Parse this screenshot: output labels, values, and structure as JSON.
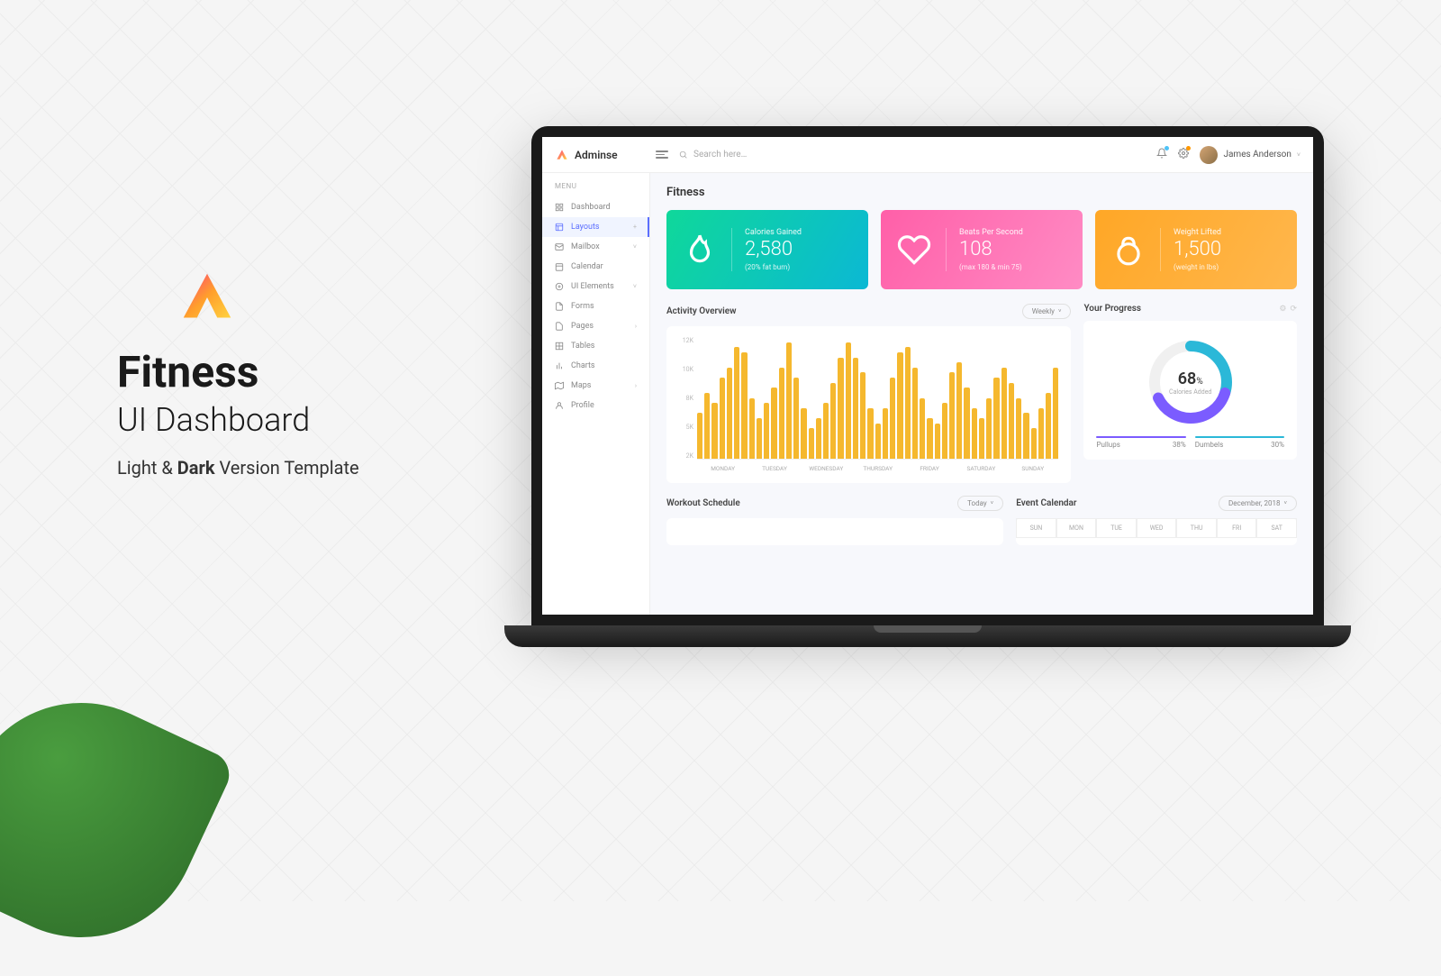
{
  "promo": {
    "title": "Fitness",
    "subtitle": "UI Dashboard",
    "tagline_pre": "Light & ",
    "tagline_bold": "Dark",
    "tagline_post": " Version Template"
  },
  "brand": "Adminse",
  "search": {
    "placeholder": "Search here…"
  },
  "user": {
    "name": "James Anderson"
  },
  "sidebar": {
    "label": "MENU",
    "items": [
      {
        "label": "Dashboard",
        "icon": "grid",
        "expand": false
      },
      {
        "label": "Layouts",
        "icon": "layout",
        "active": true,
        "expand": true,
        "caret": "+"
      },
      {
        "label": "Mailbox",
        "icon": "mail",
        "expand": true,
        "caret": "˅"
      },
      {
        "label": "Calendar",
        "icon": "calendar",
        "expand": false
      },
      {
        "label": "UI Elements",
        "icon": "ui",
        "expand": true,
        "caret": "˅"
      },
      {
        "label": "Forms",
        "icon": "form",
        "expand": false
      },
      {
        "label": "Pages",
        "icon": "pages",
        "expand": true,
        "caret": "›"
      },
      {
        "label": "Tables",
        "icon": "table",
        "expand": false
      },
      {
        "label": "Charts",
        "icon": "chart",
        "expand": false
      },
      {
        "label": "Maps",
        "icon": "map",
        "expand": true,
        "caret": "›"
      },
      {
        "label": "Profile",
        "icon": "profile",
        "expand": false
      }
    ]
  },
  "page": {
    "title": "Fitness"
  },
  "stat_cards": [
    {
      "label": "Calories Gained",
      "value": "2,580",
      "sub": "(20% fat burn)",
      "icon": "flame"
    },
    {
      "label": "Beats Per Second",
      "value": "108",
      "sub": "(max 180 & min 75)",
      "icon": "heart"
    },
    {
      "label": "Weight Lifted",
      "value": "1,500",
      "sub": "(weight in lbs)",
      "icon": "kettlebell"
    }
  ],
  "activity": {
    "title": "Activity Overview",
    "range": "Weekly"
  },
  "progress": {
    "title": "Your Progress",
    "percent": "68",
    "percent_sign": "%",
    "label": "Calories Added",
    "legend": [
      {
        "name": "Pullups",
        "value": "38%",
        "color": "#7b5cff"
      },
      {
        "name": "Dumbels",
        "value": "30%",
        "color": "#2bb8d8"
      }
    ]
  },
  "workout": {
    "title": "Workout Schedule",
    "range": "Today"
  },
  "calendar": {
    "title": "Event Calendar",
    "range": "December, 2018",
    "days": [
      "SUN",
      "MON",
      "TUE",
      "WED",
      "THU",
      "FRI",
      "SAT"
    ]
  },
  "chart_data": {
    "type": "bar",
    "title": "Activity Overview",
    "ylabel": "",
    "ylim": [
      0,
      12
    ],
    "y_ticks": [
      "12K",
      "10K",
      "8K",
      "5K",
      "2K"
    ],
    "categories": [
      "MONDAY",
      "TUESDAY",
      "WEDNESDAY",
      "THURSDAY",
      "FRIDAY",
      "SATURDAY",
      "SUNDAY"
    ],
    "values": [
      4.5,
      6.5,
      5.5,
      8,
      9,
      11,
      10.5,
      6,
      4,
      5.5,
      7,
      9,
      11.5,
      8,
      5,
      3,
      4,
      5.5,
      7.5,
      10,
      11.5,
      10,
      8.5,
      5,
      3.5,
      5,
      8,
      10.5,
      11,
      9,
      6,
      4,
      3.5,
      5.5,
      8.5,
      9.5,
      7,
      5,
      4,
      6,
      8,
      9,
      7.5,
      6,
      4.5,
      3,
      5,
      6.5,
      9
    ]
  },
  "colors": {
    "accent": "#5b6eff",
    "bar": "#f5b82e",
    "card1a": "#0fd89a",
    "card1b": "#0bb8d4",
    "card2a": "#ff5fa8",
    "card2b": "#ff8bc4",
    "card3a": "#ffa726",
    "card3b": "#ffb74d"
  }
}
